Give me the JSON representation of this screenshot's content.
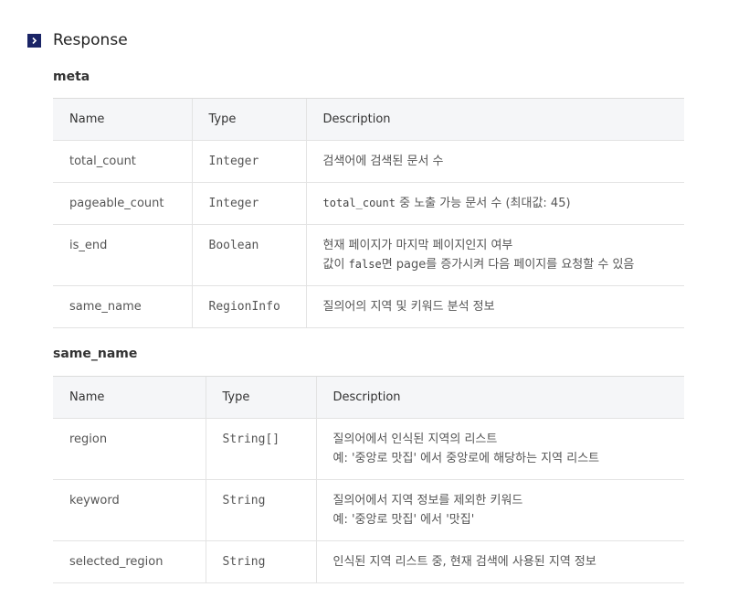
{
  "section": {
    "title": "Response"
  },
  "meta": {
    "title": "meta",
    "headers": [
      "Name",
      "Type",
      "Description"
    ],
    "rows": [
      {
        "name": "total_count",
        "type": "Integer",
        "desc": [
          "검색어에 검색된 문서 수"
        ]
      },
      {
        "name": "pageable_count",
        "type": "Integer",
        "desc_code": "total_count",
        "desc_rest": " 중 노출 가능 문서 수 (최대값: 45)"
      },
      {
        "name": "is_end",
        "type": "Boolean",
        "desc": [
          "현재 페이지가 마지막 페이지인지 여부"
        ],
        "desc2_pre": "값이 ",
        "desc2_code": "false",
        "desc2_post": "면 page를 증가시켜 다음 페이지를 요청할 수 있음"
      },
      {
        "name": "same_name",
        "type": "RegionInfo",
        "desc": [
          "질의어의 지역 및 키워드 분석 정보"
        ]
      }
    ]
  },
  "same_name": {
    "title": "same_name",
    "headers": [
      "Name",
      "Type",
      "Description"
    ],
    "rows": [
      {
        "name": "region",
        "type": "String[]",
        "desc": [
          "질의어에서 인식된 지역의 리스트",
          "예: '중앙로 맛집' 에서 중앙로에 해당하는 지역 리스트"
        ]
      },
      {
        "name": "keyword",
        "type": "String",
        "desc": [
          "질의어에서 지역 정보를 제외한 키워드",
          "예: '중앙로 맛집' 에서 '맛집'"
        ]
      },
      {
        "name": "selected_region",
        "type": "String",
        "desc": [
          "인식된 지역 리스트 중, 현재 검색에 사용된 지역 정보"
        ]
      }
    ]
  }
}
